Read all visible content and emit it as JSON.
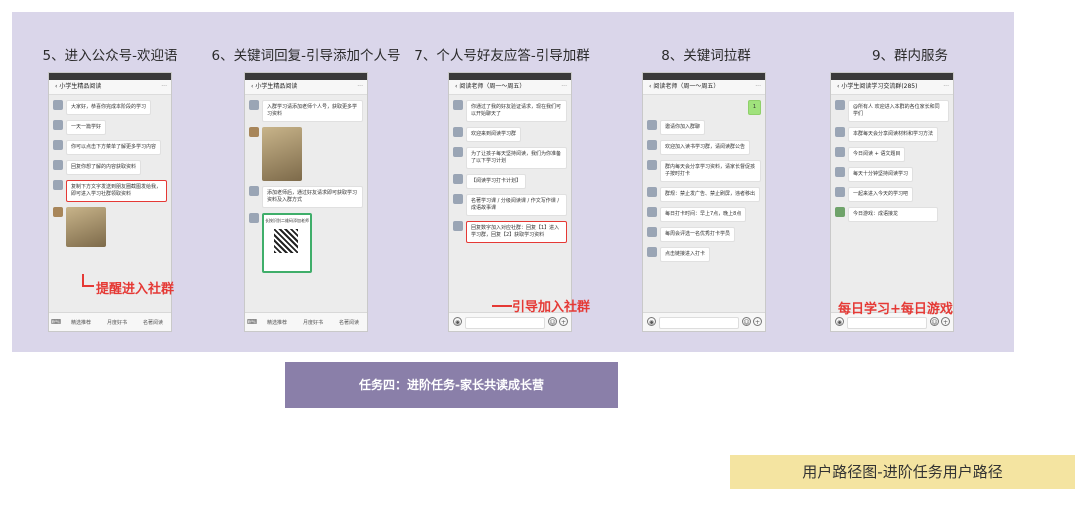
{
  "steps": [
    {
      "title": "5、进入公众号-欢迎语",
      "header": "小学生精品阅读",
      "bubbles": [
        "大家好，恭喜你完成本阶段的学习",
        "一天一篇学好",
        "你可以点击下方菜单了解更多学习内容",
        "回复你想了解的内容获取资料",
        "复制下方文字发送到朋友圈截图发给我，即可进入学习社群领取资料"
      ],
      "bottom": [
        "精选推荐",
        "月度好书",
        "名著阅读"
      ],
      "annotation": "提醒进入社群"
    },
    {
      "title": "6、关键词回复-引导添加个人号",
      "header": "小学生精品阅读",
      "bubbles": [
        "入群学习请添加老师个人号，获取更多学习资料",
        "添加老师后，通过好友请求即可获取学习资料及入群方式"
      ],
      "bottom": [
        "精选推荐",
        "月度好书",
        "名著阅读"
      ],
      "qr_caption": "长按识别二维码添加老师"
    },
    {
      "title": "7、个人号好友应答-引导加群",
      "header": "阅读老师（周一～周五）",
      "bubbles": [
        "你通过了我的好友验证请求，现在我们可以开始聊天了",
        "欢迎来到阅读学习群",
        "为了让孩子每天坚持阅读，我们为你准备了以下学习计划",
        "【阅读学习打卡计划】",
        "名著学习课 / 分级阅读课 / 作文写作课 / 成语故事课"
      ],
      "highlight": "回复数字加入对应社群：回复【1】进入学习群，回复【2】获取学习资料",
      "annotation": "引导加入社群"
    },
    {
      "title": "8、关键词拉群",
      "header": "阅读老师（周一～周五）",
      "bubbles": [
        "邀请你加入群聊",
        "欢迎加入读书学习群，请阅读群公告",
        "群内每天会分享学习资料，请家长督促孩子按时打卡",
        "群规：禁止发广告、禁止刷屏，违者移出",
        "每日打卡时间：早上7点，晚上8点",
        "每周会评选一名优秀打卡学员",
        "点击链接进入打卡"
      ]
    },
    {
      "title": "9、群内服务",
      "header": "小学生阅读学习交流群(285)",
      "bubbles": [
        "@所有人 欢迎进入本群的各位家长和同学们",
        "本群每天会分享阅读材料和学习方法",
        "今日阅读 + 语文题目",
        "每天十分钟坚持阅读学习",
        "一起来进入今天的学习吧"
      ],
      "game_title": "今日游戏：成语接龙",
      "annotation": "每日学习+每日游戏"
    }
  ],
  "task_label": "任务四：进阶任务-家长共读成长营",
  "footer_label": "用户路径图-进阶任务用户路径",
  "colors": {
    "panel": "#dad6ea",
    "task_box": "#8a7fa9",
    "footer": "#f4e4a1",
    "annotation": "#e53935"
  }
}
